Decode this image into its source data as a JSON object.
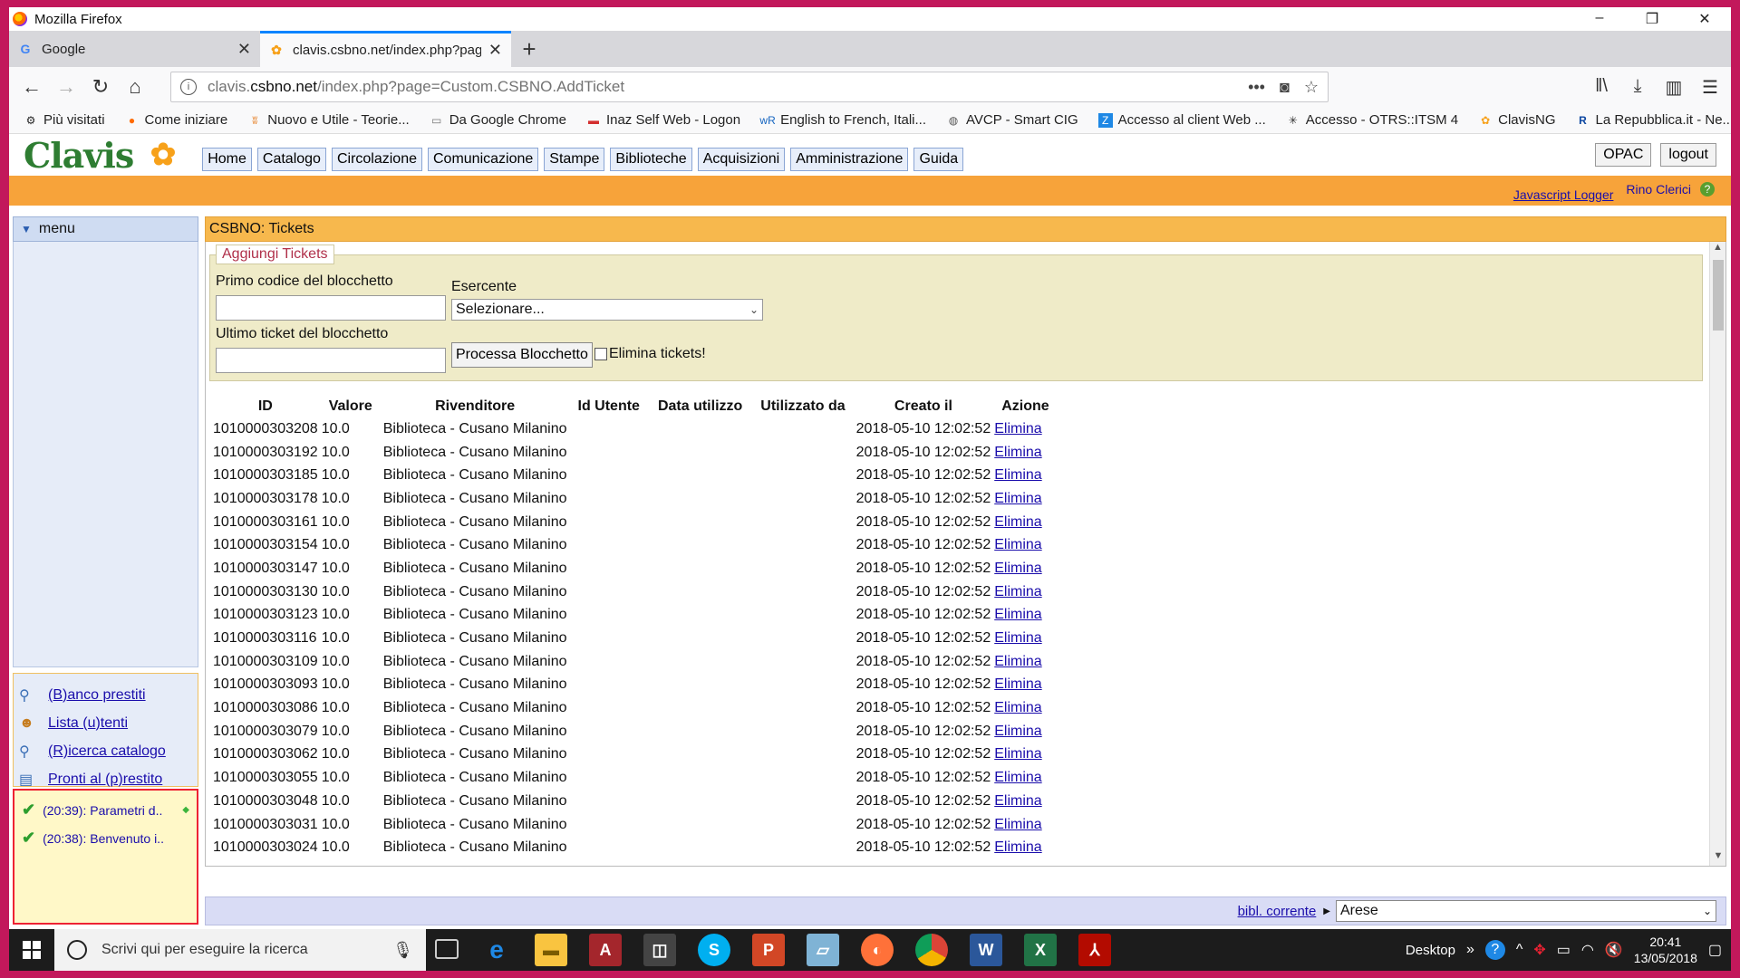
{
  "window": {
    "title": "Mozilla Firefox",
    "controls": [
      "–",
      "❐",
      "✕"
    ]
  },
  "tabs": [
    {
      "title": "Google",
      "active": false
    },
    {
      "title": "clavis.csbno.net/index.php?page=Custom.CSBNO.AddTicket",
      "active": true
    }
  ],
  "urlbar": {
    "prefix": "clavis.",
    "host": "csbno.net",
    "path": "/index.php?page=Custom.CSBNO.AddTicket"
  },
  "bookmarks": [
    {
      "label": "Più visitati",
      "icon": "gear-icon"
    },
    {
      "label": "Come iniziare",
      "icon": "firefox-icon"
    },
    {
      "label": "Nuovo e Utile - Teorie...",
      "icon": "rss-icon"
    },
    {
      "label": "Da Google Chrome",
      "icon": "folder-icon"
    },
    {
      "label": "Inaz Self Web - Logon",
      "icon": "inaz-icon"
    },
    {
      "label": "English to French, Itali...",
      "icon": "wr-icon"
    },
    {
      "label": "AVCP - Smart CIG",
      "icon": "globe-icon"
    },
    {
      "label": "Accesso al client Web ...",
      "icon": "zimbra-icon"
    },
    {
      "label": "Accesso - OTRS::ITSM 4",
      "icon": "otrs-icon"
    },
    {
      "label": "ClavisNG",
      "icon": "clavis-icon"
    },
    {
      "label": "La Repubblica.it - Ne...",
      "icon": "repubblica-icon"
    }
  ],
  "app": {
    "logo": "Clavis",
    "menu": [
      "Home",
      "Catalogo",
      "Circolazione",
      "Comunicazione",
      "Stampe",
      "Biblioteche",
      "Acquisizioni",
      "Amministrazione",
      "Guida"
    ],
    "opac_label": "OPAC",
    "logout_label": "logout",
    "js_logger": "Javascript Logger",
    "user": "Rino Clerici"
  },
  "sidebar": {
    "menu_label": "menu",
    "shortcuts": [
      {
        "label": "(B)anco prestiti",
        "icon": "desk-icon"
      },
      {
        "label": "Lista (u)tenti",
        "icon": "users-icon"
      },
      {
        "label": "(R)icerca catalogo",
        "icon": "search-icon"
      },
      {
        "label": "Pronti al (p)restito",
        "icon": "books-icon"
      }
    ],
    "notices": [
      {
        "text": "(20:39): Parametri d.."
      },
      {
        "text": "(20:38): Benvenuto i.."
      }
    ]
  },
  "content": {
    "title": "CSBNO: Tickets",
    "form": {
      "legend": "Aggiungi Tickets",
      "first_code_label": "Primo codice del blocchetto",
      "first_code_value": "",
      "last_ticket_label": "Ultimo ticket del blocchetto",
      "last_ticket_value": "",
      "merchant_label": "Esercente",
      "merchant_value": "Selezionare...",
      "process_button": "Processa Blocchetto",
      "delete_checkbox": "Elimina tickets!"
    },
    "table": {
      "headers": [
        "ID",
        "Valore",
        "Rivenditore",
        "Id Utente",
        "Data utilizzo",
        "Utilizzato da",
        "Creato il",
        "Azione"
      ],
      "rows": [
        [
          "1010000303208",
          "10.0",
          "Biblioteca - Cusano Milanino",
          "",
          "",
          "",
          "2018-05-10 12:02:52",
          "Elimina"
        ],
        [
          "1010000303192",
          "10.0",
          "Biblioteca - Cusano Milanino",
          "",
          "",
          "",
          "2018-05-10 12:02:52",
          "Elimina"
        ],
        [
          "1010000303185",
          "10.0",
          "Biblioteca - Cusano Milanino",
          "",
          "",
          "",
          "2018-05-10 12:02:52",
          "Elimina"
        ],
        [
          "1010000303178",
          "10.0",
          "Biblioteca - Cusano Milanino",
          "",
          "",
          "",
          "2018-05-10 12:02:52",
          "Elimina"
        ],
        [
          "1010000303161",
          "10.0",
          "Biblioteca - Cusano Milanino",
          "",
          "",
          "",
          "2018-05-10 12:02:52",
          "Elimina"
        ],
        [
          "1010000303154",
          "10.0",
          "Biblioteca - Cusano Milanino",
          "",
          "",
          "",
          "2018-05-10 12:02:52",
          "Elimina"
        ],
        [
          "1010000303147",
          "10.0",
          "Biblioteca - Cusano Milanino",
          "",
          "",
          "",
          "2018-05-10 12:02:52",
          "Elimina"
        ],
        [
          "1010000303130",
          "10.0",
          "Biblioteca - Cusano Milanino",
          "",
          "",
          "",
          "2018-05-10 12:02:52",
          "Elimina"
        ],
        [
          "1010000303123",
          "10.0",
          "Biblioteca - Cusano Milanino",
          "",
          "",
          "",
          "2018-05-10 12:02:52",
          "Elimina"
        ],
        [
          "1010000303116",
          "10.0",
          "Biblioteca - Cusano Milanino",
          "",
          "",
          "",
          "2018-05-10 12:02:52",
          "Elimina"
        ],
        [
          "1010000303109",
          "10.0",
          "Biblioteca - Cusano Milanino",
          "",
          "",
          "",
          "2018-05-10 12:02:52",
          "Elimina"
        ],
        [
          "1010000303093",
          "10.0",
          "Biblioteca - Cusano Milanino",
          "",
          "",
          "",
          "2018-05-10 12:02:52",
          "Elimina"
        ],
        [
          "1010000303086",
          "10.0",
          "Biblioteca - Cusano Milanino",
          "",
          "",
          "",
          "2018-05-10 12:02:52",
          "Elimina"
        ],
        [
          "1010000303079",
          "10.0",
          "Biblioteca - Cusano Milanino",
          "",
          "",
          "",
          "2018-05-10 12:02:52",
          "Elimina"
        ],
        [
          "1010000303062",
          "10.0",
          "Biblioteca - Cusano Milanino",
          "",
          "",
          "",
          "2018-05-10 12:02:52",
          "Elimina"
        ],
        [
          "1010000303055",
          "10.0",
          "Biblioteca - Cusano Milanino",
          "",
          "",
          "",
          "2018-05-10 12:02:52",
          "Elimina"
        ],
        [
          "1010000303048",
          "10.0",
          "Biblioteca - Cusano Milanino",
          "",
          "",
          "",
          "2018-05-10 12:02:52",
          "Elimina"
        ],
        [
          "1010000303031",
          "10.0",
          "Biblioteca - Cusano Milanino",
          "",
          "",
          "",
          "2018-05-10 12:02:52",
          "Elimina"
        ],
        [
          "1010000303024",
          "10.0",
          "Biblioteca - Cusano Milanino",
          "",
          "",
          "",
          "2018-05-10 12:02:52",
          "Elimina"
        ]
      ]
    }
  },
  "statusbar": {
    "library_link": "bibl. corrente",
    "library_value": "Arese"
  },
  "taskbar": {
    "search_placeholder": "Scrivi qui per eseguire la ricerca",
    "desktop_label": "Desktop",
    "time": "20:41",
    "date": "13/05/2018"
  },
  "colors": {
    "accent_orange": "#f7a33a",
    "link": "#1a0dab",
    "frame": "#c2185b"
  }
}
